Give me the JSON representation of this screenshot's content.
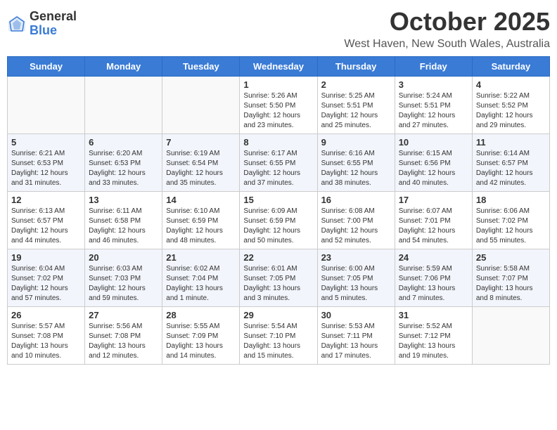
{
  "header": {
    "logo_general": "General",
    "logo_blue": "Blue",
    "month": "October 2025",
    "location": "West Haven, New South Wales, Australia"
  },
  "weekdays": [
    "Sunday",
    "Monday",
    "Tuesday",
    "Wednesday",
    "Thursday",
    "Friday",
    "Saturday"
  ],
  "weeks": [
    [
      {
        "day": "",
        "info": ""
      },
      {
        "day": "",
        "info": ""
      },
      {
        "day": "",
        "info": ""
      },
      {
        "day": "1",
        "info": "Sunrise: 5:26 AM\nSunset: 5:50 PM\nDaylight: 12 hours\nand 23 minutes."
      },
      {
        "day": "2",
        "info": "Sunrise: 5:25 AM\nSunset: 5:51 PM\nDaylight: 12 hours\nand 25 minutes."
      },
      {
        "day": "3",
        "info": "Sunrise: 5:24 AM\nSunset: 5:51 PM\nDaylight: 12 hours\nand 27 minutes."
      },
      {
        "day": "4",
        "info": "Sunrise: 5:22 AM\nSunset: 5:52 PM\nDaylight: 12 hours\nand 29 minutes."
      }
    ],
    [
      {
        "day": "5",
        "info": "Sunrise: 6:21 AM\nSunset: 6:53 PM\nDaylight: 12 hours\nand 31 minutes."
      },
      {
        "day": "6",
        "info": "Sunrise: 6:20 AM\nSunset: 6:53 PM\nDaylight: 12 hours\nand 33 minutes."
      },
      {
        "day": "7",
        "info": "Sunrise: 6:19 AM\nSunset: 6:54 PM\nDaylight: 12 hours\nand 35 minutes."
      },
      {
        "day": "8",
        "info": "Sunrise: 6:17 AM\nSunset: 6:55 PM\nDaylight: 12 hours\nand 37 minutes."
      },
      {
        "day": "9",
        "info": "Sunrise: 6:16 AM\nSunset: 6:55 PM\nDaylight: 12 hours\nand 38 minutes."
      },
      {
        "day": "10",
        "info": "Sunrise: 6:15 AM\nSunset: 6:56 PM\nDaylight: 12 hours\nand 40 minutes."
      },
      {
        "day": "11",
        "info": "Sunrise: 6:14 AM\nSunset: 6:57 PM\nDaylight: 12 hours\nand 42 minutes."
      }
    ],
    [
      {
        "day": "12",
        "info": "Sunrise: 6:13 AM\nSunset: 6:57 PM\nDaylight: 12 hours\nand 44 minutes."
      },
      {
        "day": "13",
        "info": "Sunrise: 6:11 AM\nSunset: 6:58 PM\nDaylight: 12 hours\nand 46 minutes."
      },
      {
        "day": "14",
        "info": "Sunrise: 6:10 AM\nSunset: 6:59 PM\nDaylight: 12 hours\nand 48 minutes."
      },
      {
        "day": "15",
        "info": "Sunrise: 6:09 AM\nSunset: 6:59 PM\nDaylight: 12 hours\nand 50 minutes."
      },
      {
        "day": "16",
        "info": "Sunrise: 6:08 AM\nSunset: 7:00 PM\nDaylight: 12 hours\nand 52 minutes."
      },
      {
        "day": "17",
        "info": "Sunrise: 6:07 AM\nSunset: 7:01 PM\nDaylight: 12 hours\nand 54 minutes."
      },
      {
        "day": "18",
        "info": "Sunrise: 6:06 AM\nSunset: 7:02 PM\nDaylight: 12 hours\nand 55 minutes."
      }
    ],
    [
      {
        "day": "19",
        "info": "Sunrise: 6:04 AM\nSunset: 7:02 PM\nDaylight: 12 hours\nand 57 minutes."
      },
      {
        "day": "20",
        "info": "Sunrise: 6:03 AM\nSunset: 7:03 PM\nDaylight: 12 hours\nand 59 minutes."
      },
      {
        "day": "21",
        "info": "Sunrise: 6:02 AM\nSunset: 7:04 PM\nDaylight: 13 hours\nand 1 minute."
      },
      {
        "day": "22",
        "info": "Sunrise: 6:01 AM\nSunset: 7:05 PM\nDaylight: 13 hours\nand 3 minutes."
      },
      {
        "day": "23",
        "info": "Sunrise: 6:00 AM\nSunset: 7:05 PM\nDaylight: 13 hours\nand 5 minutes."
      },
      {
        "day": "24",
        "info": "Sunrise: 5:59 AM\nSunset: 7:06 PM\nDaylight: 13 hours\nand 7 minutes."
      },
      {
        "day": "25",
        "info": "Sunrise: 5:58 AM\nSunset: 7:07 PM\nDaylight: 13 hours\nand 8 minutes."
      }
    ],
    [
      {
        "day": "26",
        "info": "Sunrise: 5:57 AM\nSunset: 7:08 PM\nDaylight: 13 hours\nand 10 minutes."
      },
      {
        "day": "27",
        "info": "Sunrise: 5:56 AM\nSunset: 7:08 PM\nDaylight: 13 hours\nand 12 minutes."
      },
      {
        "day": "28",
        "info": "Sunrise: 5:55 AM\nSunset: 7:09 PM\nDaylight: 13 hours\nand 14 minutes."
      },
      {
        "day": "29",
        "info": "Sunrise: 5:54 AM\nSunset: 7:10 PM\nDaylight: 13 hours\nand 15 minutes."
      },
      {
        "day": "30",
        "info": "Sunrise: 5:53 AM\nSunset: 7:11 PM\nDaylight: 13 hours\nand 17 minutes."
      },
      {
        "day": "31",
        "info": "Sunrise: 5:52 AM\nSunset: 7:12 PM\nDaylight: 13 hours\nand 19 minutes."
      },
      {
        "day": "",
        "info": ""
      }
    ]
  ]
}
